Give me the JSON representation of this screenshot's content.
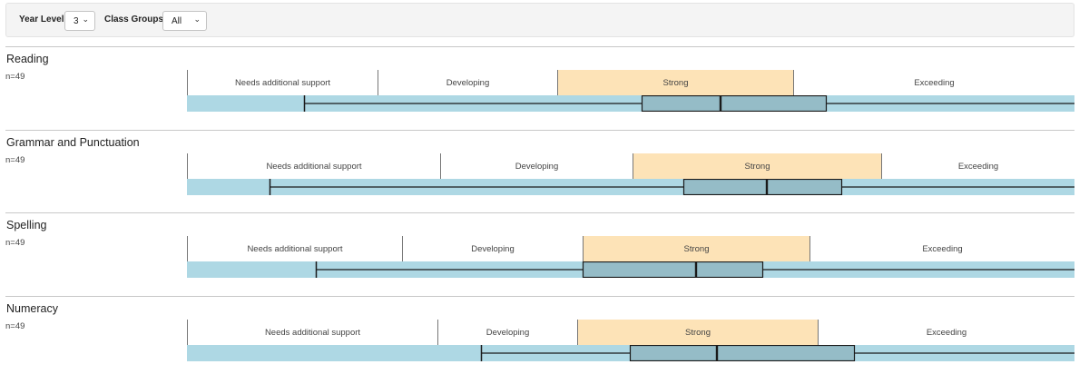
{
  "filters": {
    "year_level_label": "Year Level:",
    "year_level_value": "3",
    "class_groups_label": "Class Groups:",
    "class_groups_value": "All"
  },
  "chart_data": {
    "type": "boxplot",
    "scale": [
      0,
      978
    ],
    "band_labels": [
      "Needs additional support",
      "Developing",
      "Strong",
      "Exceeding"
    ],
    "highlighted_band": "Strong",
    "colors": {
      "fill": "#aed8e4",
      "box": "#95bcc7",
      "highlight": "#fde3b7",
      "line": "#1a1a1a"
    },
    "charts": [
      {
        "title": "Reading",
        "n": "n=49",
        "band_edges": [
          0,
          210,
          408,
          668,
          978
        ],
        "fill_end": 129,
        "whisker_low": 129,
        "q1": 501,
        "median": 588,
        "q3": 704,
        "whisker_high": 978
      },
      {
        "title": "Grammar and Punctuation",
        "n": "n=49",
        "band_edges": [
          0,
          279,
          491,
          765,
          978
        ],
        "fill_end": 91,
        "whisker_low": 91,
        "q1": 547,
        "median": 639,
        "q3": 721,
        "whisker_high": 978
      },
      {
        "title": "Spelling",
        "n": "n=49",
        "band_edges": [
          0,
          237,
          436,
          686,
          978
        ],
        "fill_end": 142,
        "whisker_low": 142,
        "q1": 436,
        "median": 561,
        "q3": 634,
        "whisker_high": 978
      },
      {
        "title": "Numeracy",
        "n": "n=49",
        "band_edges": [
          0,
          276,
          430,
          695,
          978
        ],
        "fill_end": 324,
        "whisker_low": 324,
        "q1": 488,
        "median": 584,
        "q3": 735,
        "whisker_high": 978
      }
    ]
  }
}
